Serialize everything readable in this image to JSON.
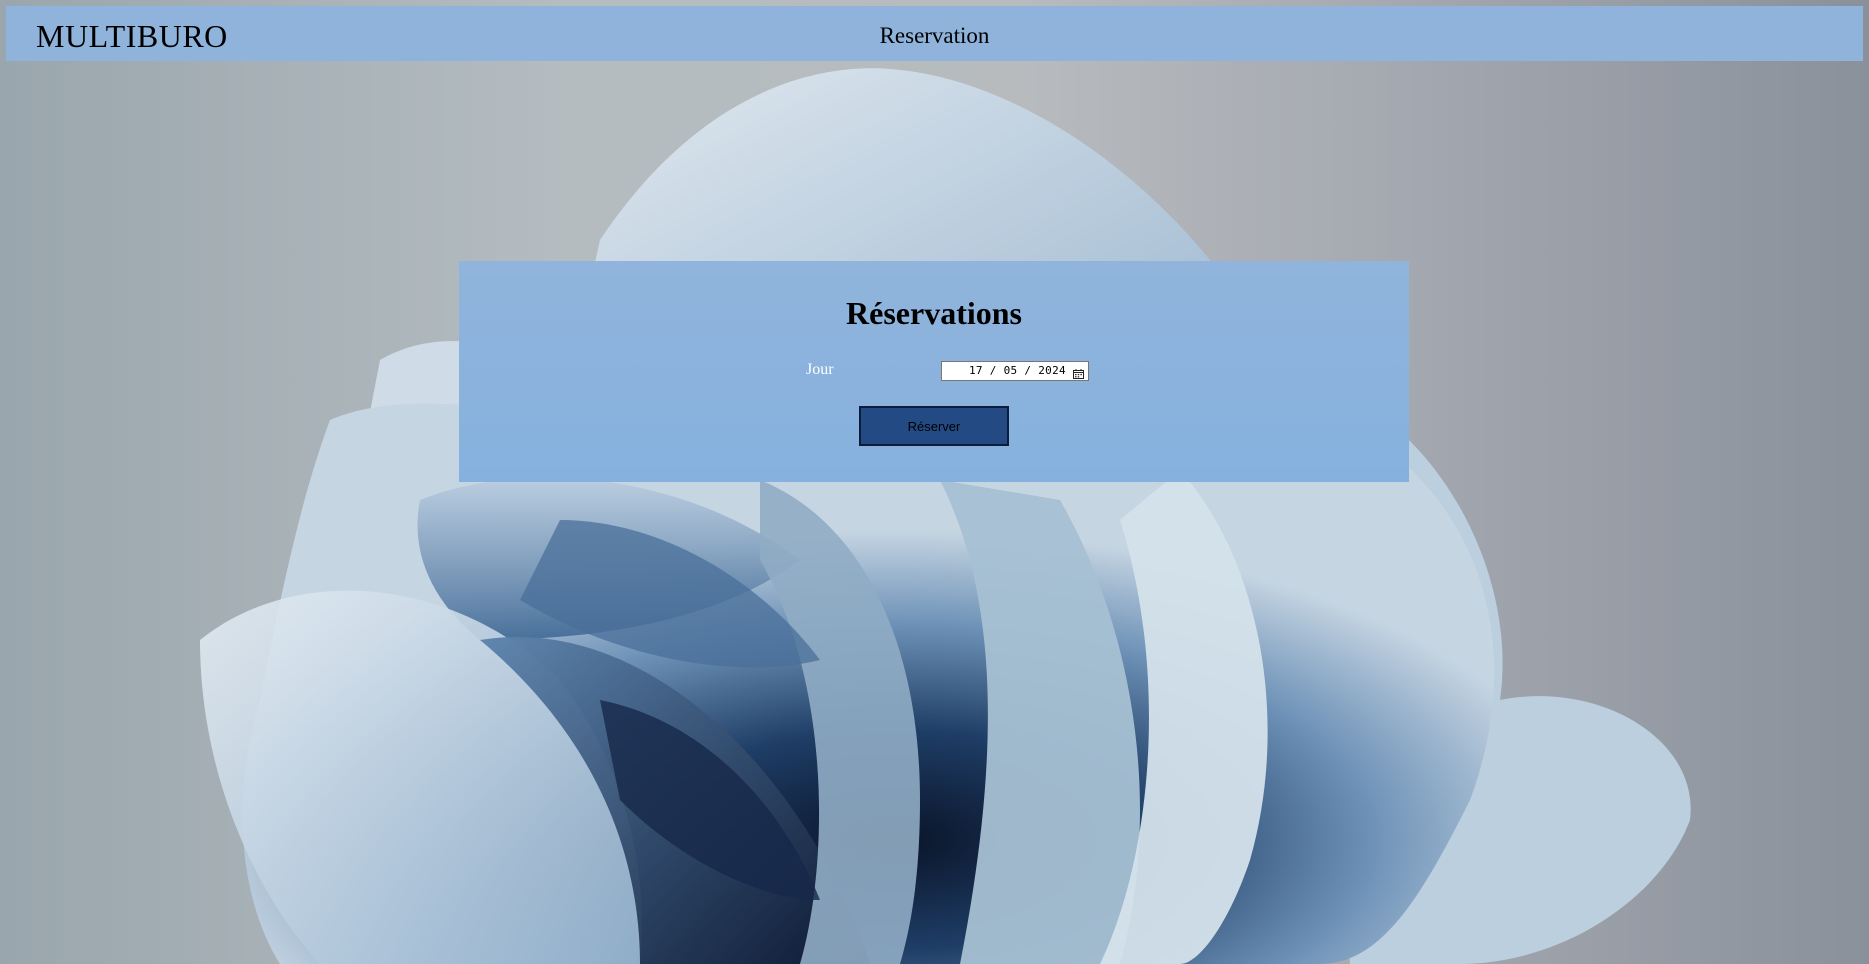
{
  "header": {
    "brand": "MULTIBURO",
    "title": "Reservation"
  },
  "reservation_form": {
    "title": "Réservations",
    "day_label": "Jour",
    "date_value": "17/05/2024",
    "submit_label": "Réserver"
  },
  "icons": {
    "calendar": "calendar-icon",
    "background": "windows-bloom-wallpaper"
  },
  "colors": {
    "header_bg": "#8fb3db",
    "panel_bg": "#8cb3dc",
    "button_bg": "#234a82",
    "label_text": "#ffffff"
  }
}
